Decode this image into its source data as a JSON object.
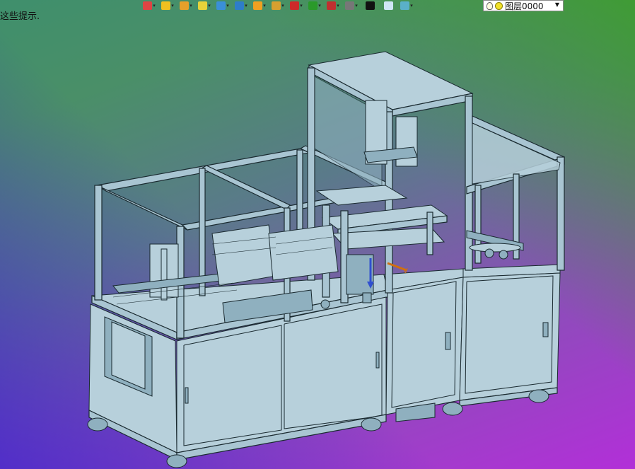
{
  "hint_text": "这些提示.",
  "toolbar": {
    "items": [
      {
        "icon": "insert-block-icon",
        "color": "#d44"
      },
      {
        "icon": "light-icon",
        "color": "#f0c020"
      },
      {
        "icon": "pencil-icon",
        "color": "#e5a02a"
      },
      {
        "icon": "eraser-icon",
        "color": "#e6d23a"
      },
      {
        "icon": "box-3d-icon",
        "color": "#3a8fd8"
      },
      {
        "icon": "cube-view-icon",
        "color": "#2e7dc9"
      },
      {
        "icon": "orbit-icon",
        "color": "#f0a020"
      },
      {
        "icon": "zoom-icon",
        "color": "#d8a030"
      },
      {
        "icon": "ucs-icon",
        "color": "#cc2a2a"
      },
      {
        "icon": "viewport-icon",
        "color": "#2a9a2a"
      },
      {
        "icon": "layout-icon",
        "color": "#c03030"
      },
      {
        "icon": "display-icon",
        "color": "#777"
      },
      {
        "icon": "line-weight-icon",
        "color": "#111"
      },
      {
        "icon": "color-swatch-icon",
        "color": "#cfe6f5"
      },
      {
        "icon": "material-icon",
        "color": "#5ab0c8"
      }
    ]
  },
  "layer_selector": {
    "value": "图层0000"
  },
  "colors": {
    "frame_fill": "#a9c5d2",
    "frame_stroke": "#1a2a30",
    "panel_fill": "#b7d0db"
  }
}
